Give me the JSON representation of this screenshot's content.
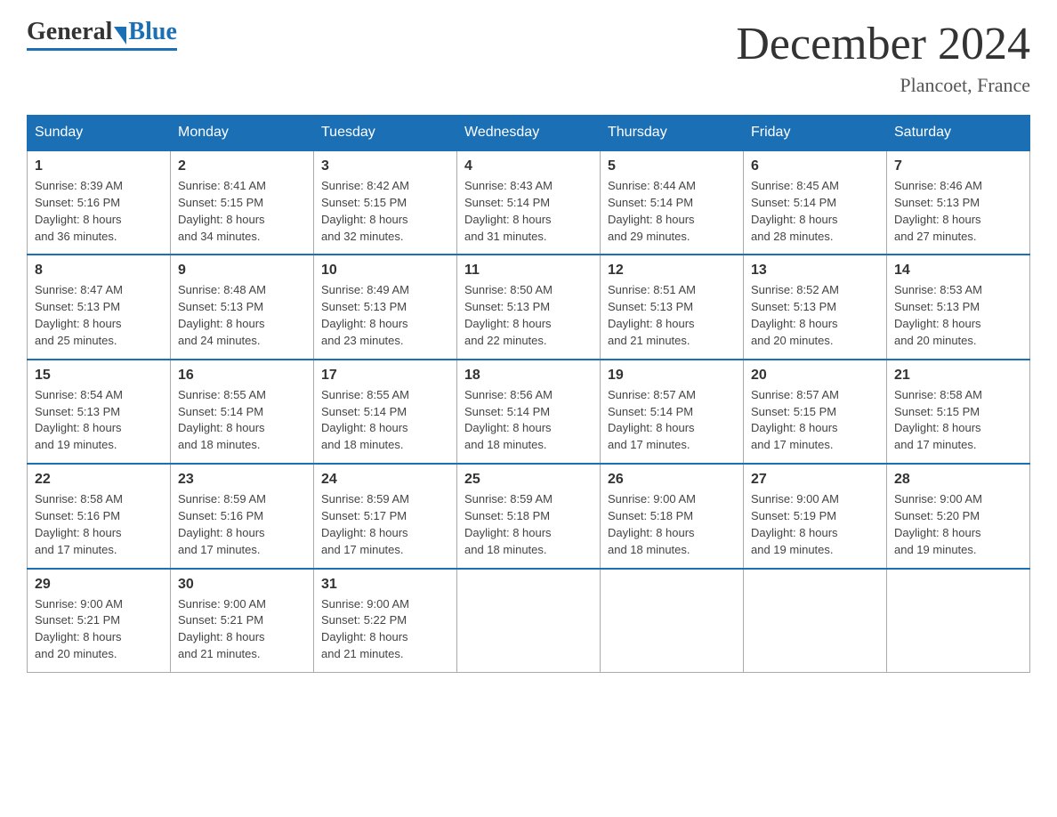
{
  "header": {
    "logo_general": "General",
    "logo_blue": "Blue",
    "month_title": "December 2024",
    "location": "Plancoet, France"
  },
  "days_of_week": [
    "Sunday",
    "Monday",
    "Tuesday",
    "Wednesday",
    "Thursday",
    "Friday",
    "Saturday"
  ],
  "weeks": [
    [
      {
        "day": "1",
        "sunrise": "8:39 AM",
        "sunset": "5:16 PM",
        "daylight": "8 hours and 36 minutes."
      },
      {
        "day": "2",
        "sunrise": "8:41 AM",
        "sunset": "5:15 PM",
        "daylight": "8 hours and 34 minutes."
      },
      {
        "day": "3",
        "sunrise": "8:42 AM",
        "sunset": "5:15 PM",
        "daylight": "8 hours and 32 minutes."
      },
      {
        "day": "4",
        "sunrise": "8:43 AM",
        "sunset": "5:14 PM",
        "daylight": "8 hours and 31 minutes."
      },
      {
        "day": "5",
        "sunrise": "8:44 AM",
        "sunset": "5:14 PM",
        "daylight": "8 hours and 29 minutes."
      },
      {
        "day": "6",
        "sunrise": "8:45 AM",
        "sunset": "5:14 PM",
        "daylight": "8 hours and 28 minutes."
      },
      {
        "day": "7",
        "sunrise": "8:46 AM",
        "sunset": "5:13 PM",
        "daylight": "8 hours and 27 minutes."
      }
    ],
    [
      {
        "day": "8",
        "sunrise": "8:47 AM",
        "sunset": "5:13 PM",
        "daylight": "8 hours and 25 minutes."
      },
      {
        "day": "9",
        "sunrise": "8:48 AM",
        "sunset": "5:13 PM",
        "daylight": "8 hours and 24 minutes."
      },
      {
        "day": "10",
        "sunrise": "8:49 AM",
        "sunset": "5:13 PM",
        "daylight": "8 hours and 23 minutes."
      },
      {
        "day": "11",
        "sunrise": "8:50 AM",
        "sunset": "5:13 PM",
        "daylight": "8 hours and 22 minutes."
      },
      {
        "day": "12",
        "sunrise": "8:51 AM",
        "sunset": "5:13 PM",
        "daylight": "8 hours and 21 minutes."
      },
      {
        "day": "13",
        "sunrise": "8:52 AM",
        "sunset": "5:13 PM",
        "daylight": "8 hours and 20 minutes."
      },
      {
        "day": "14",
        "sunrise": "8:53 AM",
        "sunset": "5:13 PM",
        "daylight": "8 hours and 20 minutes."
      }
    ],
    [
      {
        "day": "15",
        "sunrise": "8:54 AM",
        "sunset": "5:13 PM",
        "daylight": "8 hours and 19 minutes."
      },
      {
        "day": "16",
        "sunrise": "8:55 AM",
        "sunset": "5:14 PM",
        "daylight": "8 hours and 18 minutes."
      },
      {
        "day": "17",
        "sunrise": "8:55 AM",
        "sunset": "5:14 PM",
        "daylight": "8 hours and 18 minutes."
      },
      {
        "day": "18",
        "sunrise": "8:56 AM",
        "sunset": "5:14 PM",
        "daylight": "8 hours and 18 minutes."
      },
      {
        "day": "19",
        "sunrise": "8:57 AM",
        "sunset": "5:14 PM",
        "daylight": "8 hours and 17 minutes."
      },
      {
        "day": "20",
        "sunrise": "8:57 AM",
        "sunset": "5:15 PM",
        "daylight": "8 hours and 17 minutes."
      },
      {
        "day": "21",
        "sunrise": "8:58 AM",
        "sunset": "5:15 PM",
        "daylight": "8 hours and 17 minutes."
      }
    ],
    [
      {
        "day": "22",
        "sunrise": "8:58 AM",
        "sunset": "5:16 PM",
        "daylight": "8 hours and 17 minutes."
      },
      {
        "day": "23",
        "sunrise": "8:59 AM",
        "sunset": "5:16 PM",
        "daylight": "8 hours and 17 minutes."
      },
      {
        "day": "24",
        "sunrise": "8:59 AM",
        "sunset": "5:17 PM",
        "daylight": "8 hours and 17 minutes."
      },
      {
        "day": "25",
        "sunrise": "8:59 AM",
        "sunset": "5:18 PM",
        "daylight": "8 hours and 18 minutes."
      },
      {
        "day": "26",
        "sunrise": "9:00 AM",
        "sunset": "5:18 PM",
        "daylight": "8 hours and 18 minutes."
      },
      {
        "day": "27",
        "sunrise": "9:00 AM",
        "sunset": "5:19 PM",
        "daylight": "8 hours and 19 minutes."
      },
      {
        "day": "28",
        "sunrise": "9:00 AM",
        "sunset": "5:20 PM",
        "daylight": "8 hours and 19 minutes."
      }
    ],
    [
      {
        "day": "29",
        "sunrise": "9:00 AM",
        "sunset": "5:21 PM",
        "daylight": "8 hours and 20 minutes."
      },
      {
        "day": "30",
        "sunrise": "9:00 AM",
        "sunset": "5:21 PM",
        "daylight": "8 hours and 21 minutes."
      },
      {
        "day": "31",
        "sunrise": "9:00 AM",
        "sunset": "5:22 PM",
        "daylight": "8 hours and 21 minutes."
      },
      null,
      null,
      null,
      null
    ]
  ],
  "labels": {
    "sunrise": "Sunrise:",
    "sunset": "Sunset:",
    "daylight": "Daylight:"
  },
  "colors": {
    "header_bg": "#1a6fb5",
    "border_blue": "#1a6fb5"
  }
}
